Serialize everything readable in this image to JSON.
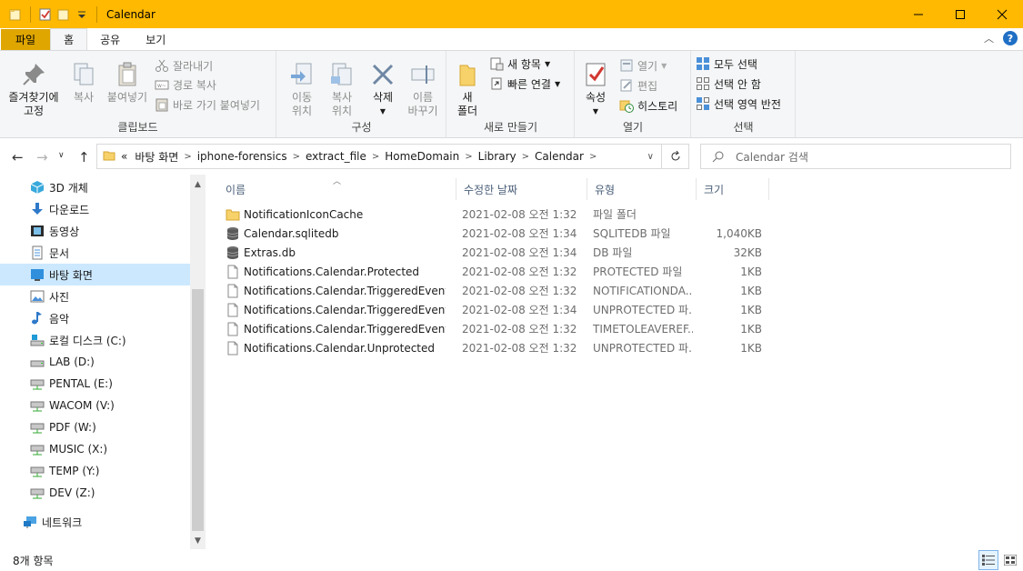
{
  "window": {
    "title": "Calendar",
    "accent_color": "#ffb900",
    "minimize_icon": "minimize-icon",
    "maximize_icon": "maximize-icon",
    "close_icon": "close-icon"
  },
  "ribbon_tabs": {
    "file": "파일",
    "home": "홈",
    "share": "공유",
    "view": "보기"
  },
  "ribbon": {
    "clipboard": {
      "pin": "즐겨찾기에\n고정",
      "copy": "복사",
      "paste": "붙여넣기",
      "cut": "잘라내기",
      "copy_path": "경로 복사",
      "paste_shortcut": "바로 가기 붙여넣기",
      "label": "클립보드"
    },
    "organize": {
      "move_to": "이동\n위치",
      "copy_to": "복사\n위치",
      "delete": "삭제",
      "rename": "이름\n바꾸기",
      "label": "구성"
    },
    "new": {
      "new_folder": "새\n폴더",
      "new_item": "새 항목",
      "easy_access": "빠른 연결",
      "label": "새로 만들기"
    },
    "open": {
      "properties": "속성",
      "open": "열기",
      "edit": "편집",
      "history": "히스토리",
      "label": "열기"
    },
    "select": {
      "select_all": "모두 선택",
      "select_none": "선택 안 함",
      "invert": "선택 영역 반전",
      "label": "선택"
    }
  },
  "address": {
    "overflow": "«",
    "crumbs": [
      "바탕 화면",
      "iphone-forensics",
      "extract_file",
      "HomeDomain",
      "Library",
      "Calendar"
    ],
    "search_placeholder": "Calendar 검색"
  },
  "nav_pane": {
    "items": [
      {
        "label": "3D 개체",
        "icon": "3d-objects-icon"
      },
      {
        "label": "다운로드",
        "icon": "downloads-icon"
      },
      {
        "label": "동영상",
        "icon": "videos-icon"
      },
      {
        "label": "문서",
        "icon": "documents-icon"
      },
      {
        "label": "바탕 화면",
        "icon": "desktop-icon",
        "selected": true
      },
      {
        "label": "사진",
        "icon": "pictures-icon"
      },
      {
        "label": "음악",
        "icon": "music-icon"
      },
      {
        "label": "로컬 디스크 (C:)",
        "icon": "local-disk-icon"
      },
      {
        "label": "LAB (D:)",
        "icon": "drive-icon"
      },
      {
        "label": "PENTAL (E:)",
        "icon": "network-drive-icon"
      },
      {
        "label": "WACOM (V:)",
        "icon": "network-drive-icon"
      },
      {
        "label": "PDF (W:)",
        "icon": "network-drive-icon"
      },
      {
        "label": "MUSIC (X:)",
        "icon": "network-drive-icon"
      },
      {
        "label": "TEMP (Y:)",
        "icon": "network-drive-icon"
      },
      {
        "label": "DEV (Z:)",
        "icon": "network-drive-icon"
      },
      {
        "label": "네트워크",
        "icon": "network-icon"
      }
    ]
  },
  "file_list": {
    "columns": {
      "name": "이름",
      "date": "수정한 날짜",
      "type": "유형",
      "size": "크기"
    },
    "rows": [
      {
        "name": "NotificationIconCache",
        "date": "2021-02-08 오전 1:32",
        "type": "파일 폴더",
        "size": "",
        "icon": "folder-icon"
      },
      {
        "name": "Calendar.sqlitedb",
        "date": "2021-02-08 오전 1:34",
        "type": "SQLITEDB 파일",
        "size": "1,040KB",
        "icon": "database-icon"
      },
      {
        "name": "Extras.db",
        "date": "2021-02-08 오전 1:34",
        "type": "DB 파일",
        "size": "32KB",
        "icon": "database-icon"
      },
      {
        "name": "Notifications.Calendar.Protected",
        "date": "2021-02-08 오전 1:32",
        "type": "PROTECTED 파일",
        "size": "1KB",
        "icon": "file-icon"
      },
      {
        "name": "Notifications.Calendar.TriggeredEvent.N...",
        "date": "2021-02-08 오전 1:32",
        "type": "NOTIFICATIONDA...",
        "size": "1KB",
        "icon": "file-icon"
      },
      {
        "name": "Notifications.Calendar.TriggeredEvent.N...",
        "date": "2021-02-08 오전 1:34",
        "type": "UNPROTECTED 파...",
        "size": "1KB",
        "icon": "file-icon"
      },
      {
        "name": "Notifications.Calendar.TriggeredEvent.Ti...",
        "date": "2021-02-08 오전 1:32",
        "type": "TIMETOLEAVEREF...",
        "size": "1KB",
        "icon": "file-icon"
      },
      {
        "name": "Notifications.Calendar.Unprotected",
        "date": "2021-02-08 오전 1:32",
        "type": "UNPROTECTED 파...",
        "size": "1KB",
        "icon": "file-icon"
      }
    ]
  },
  "status": {
    "item_count": "8개 항목"
  }
}
